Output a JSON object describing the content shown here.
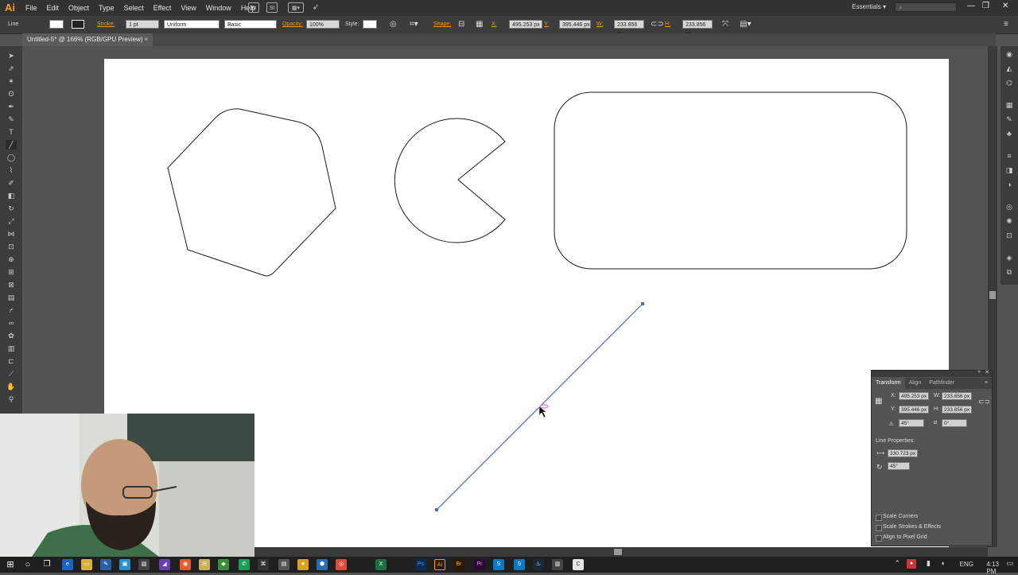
{
  "app": {
    "logo": "Ai",
    "menus": [
      "File",
      "Edit",
      "Object",
      "Type",
      "Select",
      "Effect",
      "View",
      "Window",
      "Help"
    ],
    "bridge_icons": [
      "Br",
      "St"
    ],
    "workspace": "Essentials",
    "search_placeholder": ""
  },
  "control_bar": {
    "selection_type": "Line",
    "stroke_label": "Stroke:",
    "stroke_weight": "1 pt",
    "profile": "Uniform",
    "brush": "Basic",
    "opacity_label": "Opacity:",
    "opacity": "100%",
    "style_label": "Style:",
    "shape_label": "Shape:",
    "x_label": "X:",
    "x": "495.253 px",
    "y_label": "Y:",
    "y": "395.446 px",
    "w_label": "W:",
    "w": "233.856 px",
    "h_label": "H:",
    "h": "233.856 px"
  },
  "document": {
    "tab_title": "Untitled-5* @ 166% (RGB/GPU Preview)",
    "close": "×"
  },
  "transform_panel": {
    "tabs": [
      "Transform",
      "Align",
      "Pathfinder"
    ],
    "x_label": "X:",
    "x": "495.253 px",
    "w_label": "W:",
    "w": "233.856 px",
    "y_label": "Y:",
    "y": "395.446 px",
    "h_label": "H:",
    "h": "233.856 px",
    "rotate": "45°",
    "shear": "0°",
    "line_props_label": "Line Properties:",
    "line_length": "330.723 px",
    "line_angle": "45°",
    "options": [
      "Scale Corners",
      "Scale Strokes & Effects",
      "Align to Pixel Grid"
    ]
  },
  "taskbar": {
    "apps": [
      "Ai",
      "Br",
      "Pr",
      "Ps",
      "Xl",
      "Sk",
      "St"
    ],
    "language": "ENG",
    "time": "4:13 PM"
  },
  "colors": {
    "accent": "#f29a1c",
    "path_selected": "#4a6fb5",
    "artboard": "#ffffff",
    "canvas": "#535353"
  }
}
